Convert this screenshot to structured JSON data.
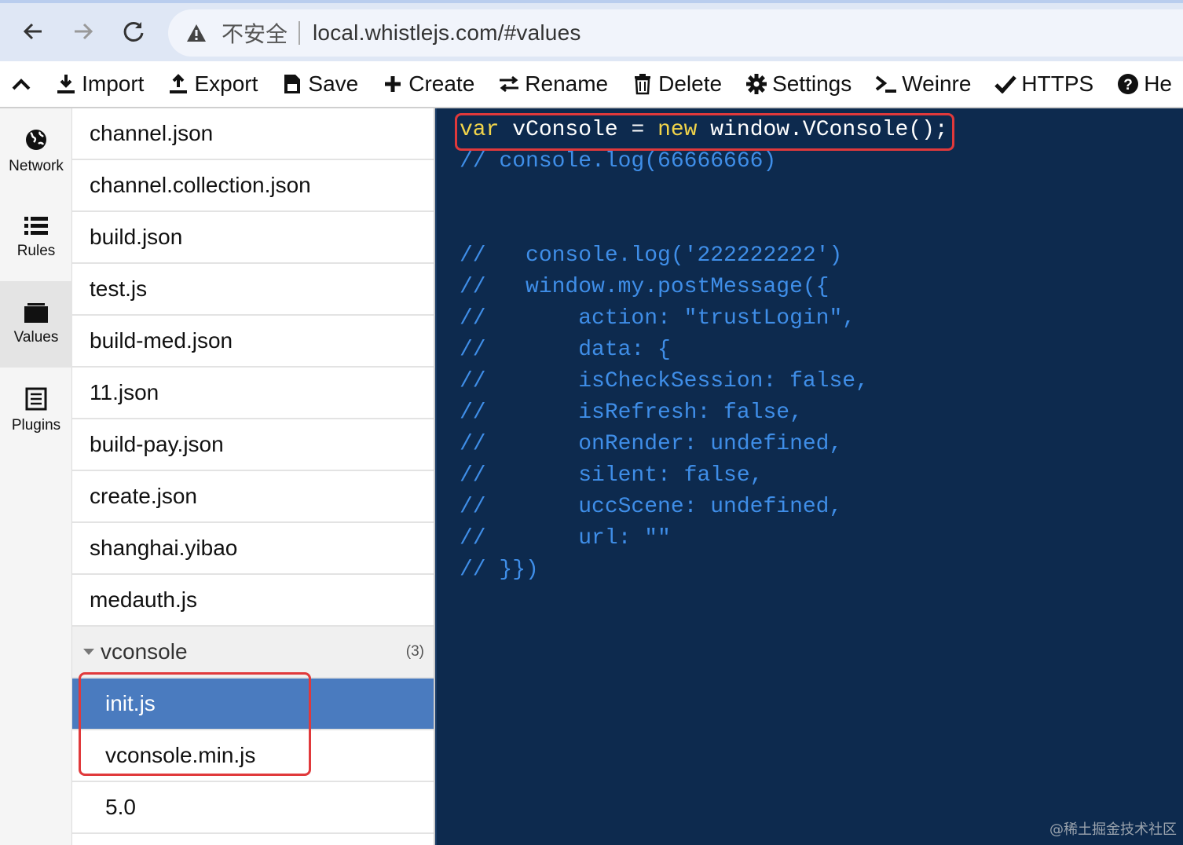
{
  "browser": {
    "insecure_label": "不安全",
    "url": "local.whistlejs.com/#values"
  },
  "toolbar": {
    "items": [
      {
        "label": "Import",
        "icon": "import-icon"
      },
      {
        "label": "Export",
        "icon": "export-icon"
      },
      {
        "label": "Save",
        "icon": "save-icon"
      },
      {
        "label": "Create",
        "icon": "plus-icon"
      },
      {
        "label": "Rename",
        "icon": "rename-icon"
      },
      {
        "label": "Delete",
        "icon": "trash-icon"
      },
      {
        "label": "Settings",
        "icon": "gear-icon"
      },
      {
        "label": "Weinre",
        "icon": "terminal-icon"
      },
      {
        "label": "HTTPS",
        "icon": "check-icon"
      },
      {
        "label": "He",
        "icon": "help-icon"
      }
    ]
  },
  "leftnav": {
    "items": [
      {
        "label": "Network",
        "icon": "globe-icon",
        "active": false
      },
      {
        "label": "Rules",
        "icon": "list-icon",
        "active": false
      },
      {
        "label": "Values",
        "icon": "folder-icon",
        "active": true
      },
      {
        "label": "Plugins",
        "icon": "plugins-icon",
        "active": false
      }
    ]
  },
  "files": [
    "channel.json",
    "channel.collection.json",
    "build.json",
    "test.js",
    "build-med.json",
    "11.json",
    "build-pay.json",
    "create.json",
    "shanghai.yibao",
    "medauth.js"
  ],
  "group": {
    "name": "vconsole",
    "count": "(3)",
    "children": [
      "init.js",
      "vconsole.min.js",
      "5.0"
    ],
    "selected": "init.js"
  },
  "code": {
    "line1": {
      "kw1": "var",
      "mid": " vConsole = ",
      "kw2": "new",
      "rest": " window.VConsole();"
    },
    "lines": [
      "// console.log(66666666)",
      "",
      "",
      "//   console.log('222222222')",
      "//   window.my.postMessage({",
      "//       action: \"trustLogin\",",
      "//       data: {",
      "//       isCheckSession: false,",
      "//       isRefresh: false,",
      "//       onRender: undefined,",
      "//       silent: false,",
      "//       uccScene: undefined,",
      "//       url: \"\"",
      "// }})"
    ]
  },
  "watermark": "@稀土掘金技术社区",
  "colors": {
    "selected_row": "#4a7bbf",
    "editor_bg": "#0d2a4e",
    "comment": "#3f8ee8",
    "keyword": "#f1d44a",
    "annotation": "#e0393b"
  }
}
